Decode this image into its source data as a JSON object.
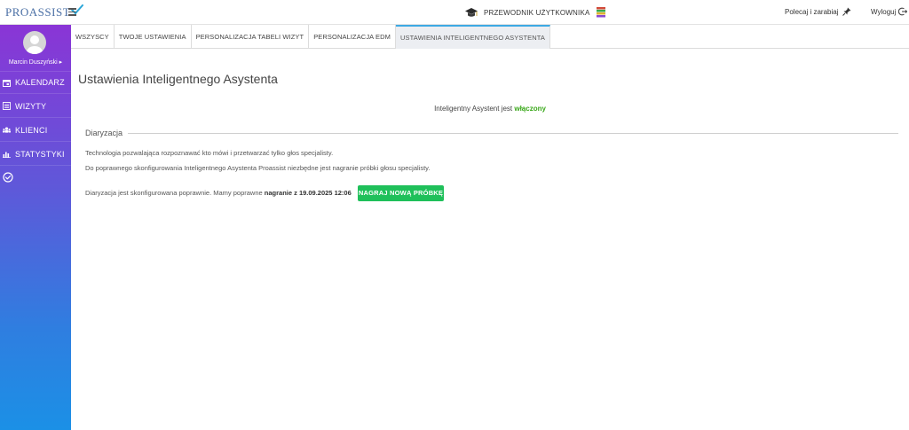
{
  "header": {
    "logo_text": "PROASSIST",
    "guide_label": "PRZEWODNIK UŻYTKOWNIKA",
    "recommend_label": "Polecaj i zarabiaj",
    "logout_label": "Wyloguj"
  },
  "sidebar": {
    "user_name": "Marcin Duszyński ▸",
    "items": [
      {
        "label": "KALENDARZ",
        "icon": "calendar-icon"
      },
      {
        "label": "WIZYTY",
        "icon": "list-icon"
      },
      {
        "label": "KLIENCI",
        "icon": "clients-icon"
      },
      {
        "label": "STATYSTYKI",
        "icon": "chart-icon"
      }
    ]
  },
  "tabs": [
    {
      "label": "WSZYSCY",
      "active": false
    },
    {
      "label": "TWOJE USTAWIENIA",
      "active": false
    },
    {
      "label": "PERSONALIZACJA TABELI WIZYT",
      "active": false
    },
    {
      "label": "PERSONALIZACJA EDM",
      "active": false
    },
    {
      "label": "USTAWIENIA INTELIGENTNEGO ASYSTENTA",
      "active": true
    }
  ],
  "main": {
    "title": "Ustawienia Inteligentnego Asystenta",
    "status_prefix": "Inteligentny Asystent jest ",
    "status_value": "włączony",
    "section_title": "Diaryzacja",
    "description_1": "Technologia pozwalająca rozpoznawać kto mówi i przetwarzać tylko głos specjalisty.",
    "description_2": "Do poprawnego skonfigurowania Inteligentnego Asystenta Proassist niezbędne jest nagranie próbki głosu specjalisty.",
    "configured_prefix": "Diaryzacja jest skonfigurowana poprawnie. Mamy poprawne ",
    "configured_value": "nagranie z 19.09.2025 12:06",
    "record_button": "NAGRAJ NOWĄ PRÓBKĘ"
  },
  "colors": {
    "accent_blue": "#3da9e3",
    "status_green": "#3aa81a",
    "button_green": "#1fc05a",
    "sidebar_top": "#8a35d6",
    "sidebar_bottom": "#1b90e6"
  }
}
